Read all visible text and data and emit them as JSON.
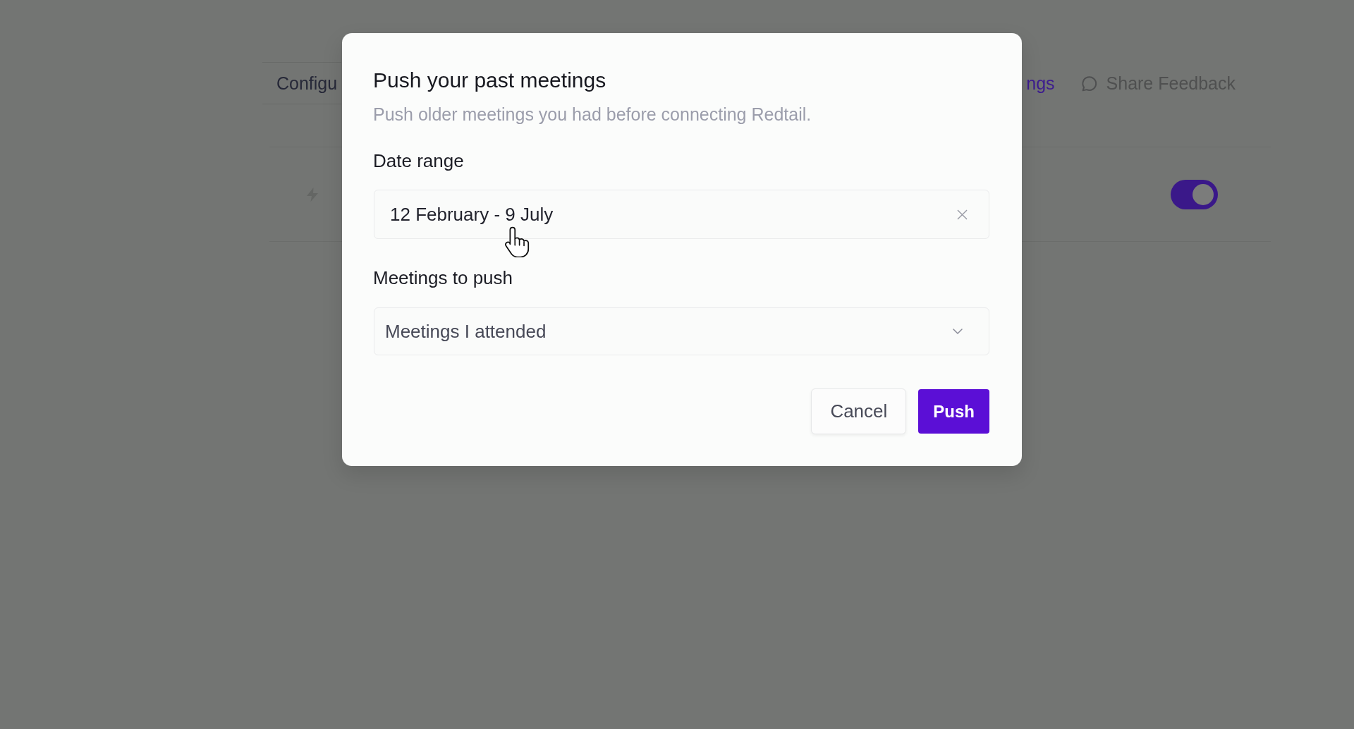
{
  "background": {
    "tabs": [
      {
        "label": "Configu",
        "selected": false
      },
      {
        "label": "ngs",
        "selected": true
      }
    ],
    "share_feedback": {
      "label": "Share Feedback"
    },
    "row": {
      "toggle": {
        "on": true
      }
    }
  },
  "dialog": {
    "title": "Push your past meetings",
    "subtitle": "Push older meetings you had before connecting Redtail.",
    "fields": [
      {
        "kind": "date_range",
        "label": "Date range",
        "value": "12 February - 9 July"
      },
      {
        "kind": "select",
        "label": "Meetings to push",
        "value": "Meetings I attended"
      }
    ],
    "buttons": [
      {
        "kind": "secondary",
        "label": "Cancel"
      },
      {
        "kind": "primary",
        "label": "Push"
      }
    ]
  }
}
